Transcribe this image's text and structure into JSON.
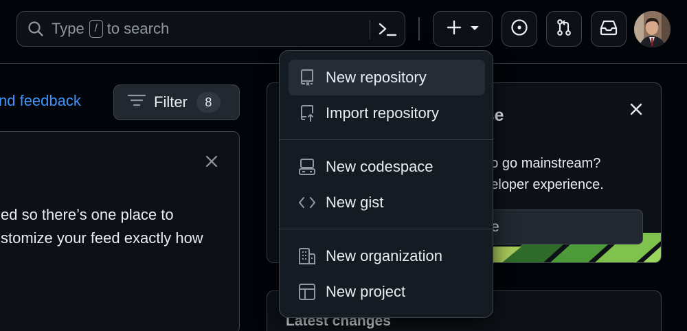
{
  "header": {
    "search": {
      "prefix": "Type",
      "key": "/",
      "suffix": "to search"
    },
    "icons": [
      "search-icon",
      "command-palette-icon",
      "plus-icon",
      "chevron-down-icon",
      "issues-icon",
      "pull-requests-icon",
      "inbox-icon"
    ]
  },
  "feed": {
    "feedback_link": "nd feedback",
    "filter": {
      "label": "Filter",
      "count": "8"
    },
    "intro_card": {
      "line1": "ed so there’s one place to",
      "line2": "stomize your feed exactly how"
    }
  },
  "promo": {
    "heading": "erse",
    "line1": "gy to go mainstream?",
    "line2": "developer experience.",
    "button": "re"
  },
  "latest": {
    "title": "Latest changes"
  },
  "create_menu": {
    "items": [
      {
        "label": "New repository",
        "icon": "repo-icon"
      },
      {
        "label": "Import repository",
        "icon": "repo-push-icon"
      },
      {
        "label": "New codespace",
        "icon": "codespaces-icon"
      },
      {
        "label": "New gist",
        "icon": "code-icon"
      },
      {
        "label": "New organization",
        "icon": "organization-icon"
      },
      {
        "label": "New project",
        "icon": "table-icon"
      }
    ]
  },
  "colors": {
    "accent_link": "#4493f8",
    "background": "#010409",
    "surface": "#0d1117",
    "menu": "#151b23",
    "border": "#3d444d"
  }
}
